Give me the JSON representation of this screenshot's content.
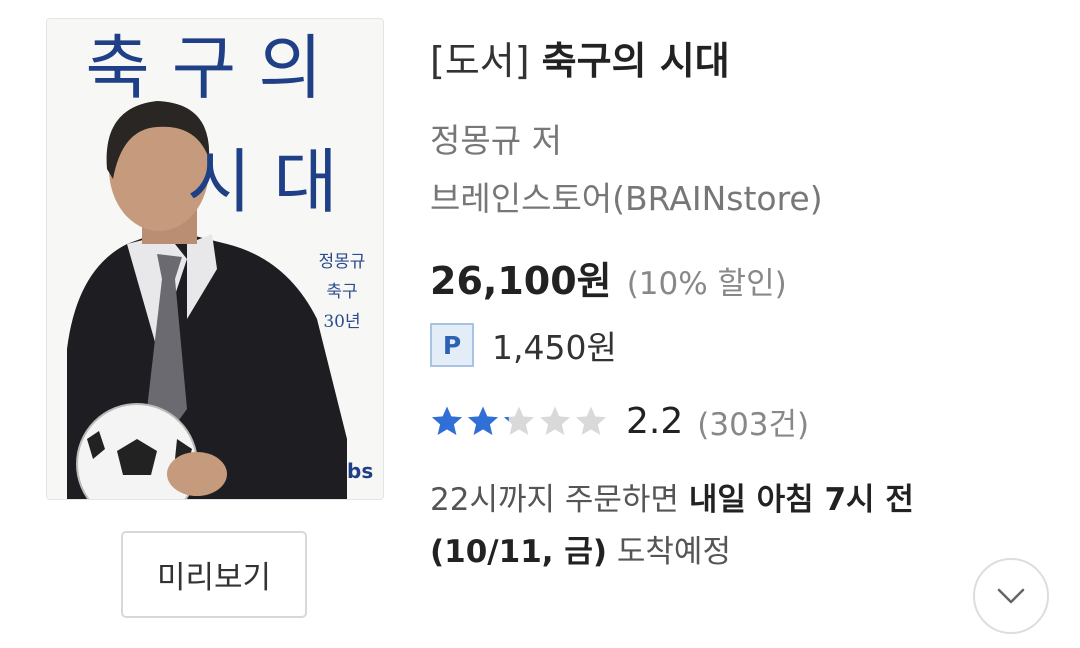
{
  "book": {
    "cover": {
      "title_line1": "축구의",
      "title_line2": "시대",
      "subtitle_lines": [
        "정몽규",
        "축구",
        "30년"
      ],
      "publisher_logo": "bs"
    },
    "category": "[도서]",
    "title": "축구의 시대",
    "author": "정몽규 저",
    "publisher": "브레인스토어(BRAINstore)",
    "price": "26,100원",
    "discount": "(10% 할인)",
    "points_badge": "P",
    "points": "1,450원",
    "rating": {
      "value": 2.2,
      "max": 5,
      "score_text": "2.2",
      "count_text": "(303건)",
      "filled_color": "#2f6fd6",
      "empty_color": "#d9d9d9"
    },
    "delivery": {
      "prefix": "22시까지 주문하면",
      "bold": "내일 아침 7시 전(10/11, 금)",
      "suffix": "도착예정"
    }
  },
  "buttons": {
    "preview_label": "미리보기",
    "expand_icon": "chevron-down-icon"
  }
}
